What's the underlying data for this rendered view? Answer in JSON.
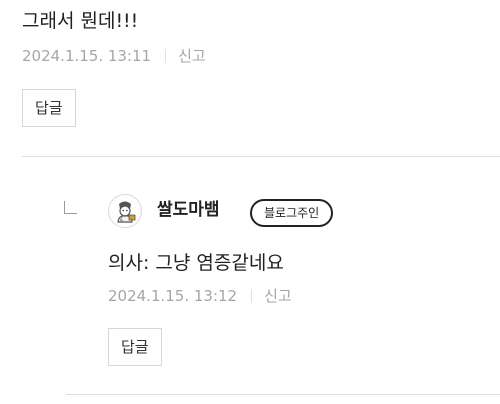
{
  "parent_comment": {
    "text": "그래서 뭔데!!!",
    "date": "2024.1.15. 13:11",
    "report_label": "신고",
    "reply_button_label": "답글"
  },
  "reply_comment": {
    "author": "쌀도마뱀",
    "owner_badge": "블로그주인",
    "text": "의사: 그냥 염증같네요",
    "date": "2024.1.15. 13:12",
    "report_label": "신고",
    "reply_button_label": "답글"
  },
  "colors": {
    "text": "#222222",
    "meta": "#a6a6a6",
    "border": "#d7d7d7",
    "divider": "#dddddd"
  },
  "icons": {
    "reply_indent": "reply-arrow-icon",
    "avatar": "avatar-illustration"
  }
}
